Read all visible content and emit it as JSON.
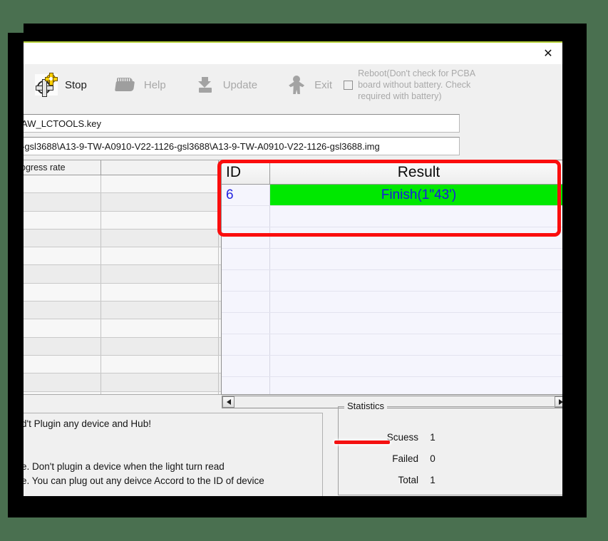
{
  "window": {
    "title": "",
    "close_label": "✕",
    "top_accent_color": "#b4cf38",
    "backdrop_color": "#4a7050"
  },
  "toolbar": {
    "buttons": [
      {
        "label": "Stop",
        "icon": "gear-icon",
        "enabled": true
      },
      {
        "label": "Help",
        "icon": "folder-icon",
        "enabled": false
      },
      {
        "label": "Update",
        "icon": "download-icon",
        "enabled": false
      },
      {
        "label": "Exit",
        "icon": "person-icon",
        "enabled": false
      }
    ],
    "reboot_checkbox": {
      "label": "Reboot(Don't check for PCBA board without battery. Check required with battery)",
      "checked": false
    }
  },
  "status_badge": {
    "icon": "green-check-icon",
    "color": "#1aa024",
    "state": "success"
  },
  "paths": {
    "key_file": "AW_LCTOOLS.key",
    "image_file": "-gsl3688\\A13-9-TW-A0910-V22-1126-gsl3688\\A13-9-TW-A0910-V22-1126-gsl3688.img"
  },
  "progress_table": {
    "headers": [
      "ogress rate",
      "",
      ""
    ],
    "row_count": 13,
    "rows": []
  },
  "result_table": {
    "headers": [
      "ID",
      "Result"
    ],
    "rows": [
      {
        "id": "6",
        "result": "Finish(1\"43')",
        "highlight_color": "#00e800",
        "text_color": "#1919e0"
      },
      {
        "id": "",
        "result": "",
        "highlight_color": "",
        "text_color": ""
      },
      {
        "id": "",
        "result": "",
        "highlight_color": "",
        "text_color": ""
      }
    ],
    "empty_row_count": 7,
    "scroll": {
      "left_arrow": "◄",
      "right_arrow": "►"
    }
  },
  "log": {
    "lines": [
      "d't Plugin any device and Hub!",
      "",
      "",
      "e. Don't plugin a device when the light turn read",
      "e. You can plug out any deivce Accord to the ID of device"
    ]
  },
  "statistics": {
    "legend": "Statistics",
    "rows": [
      {
        "label": "Scuess",
        "value": "1"
      },
      {
        "label": "Failed",
        "value": "0"
      },
      {
        "label": "Total",
        "value": "1"
      }
    ]
  },
  "annotations": {
    "result_box_color": "#fb0d0d",
    "underline_color": "#f41111"
  }
}
